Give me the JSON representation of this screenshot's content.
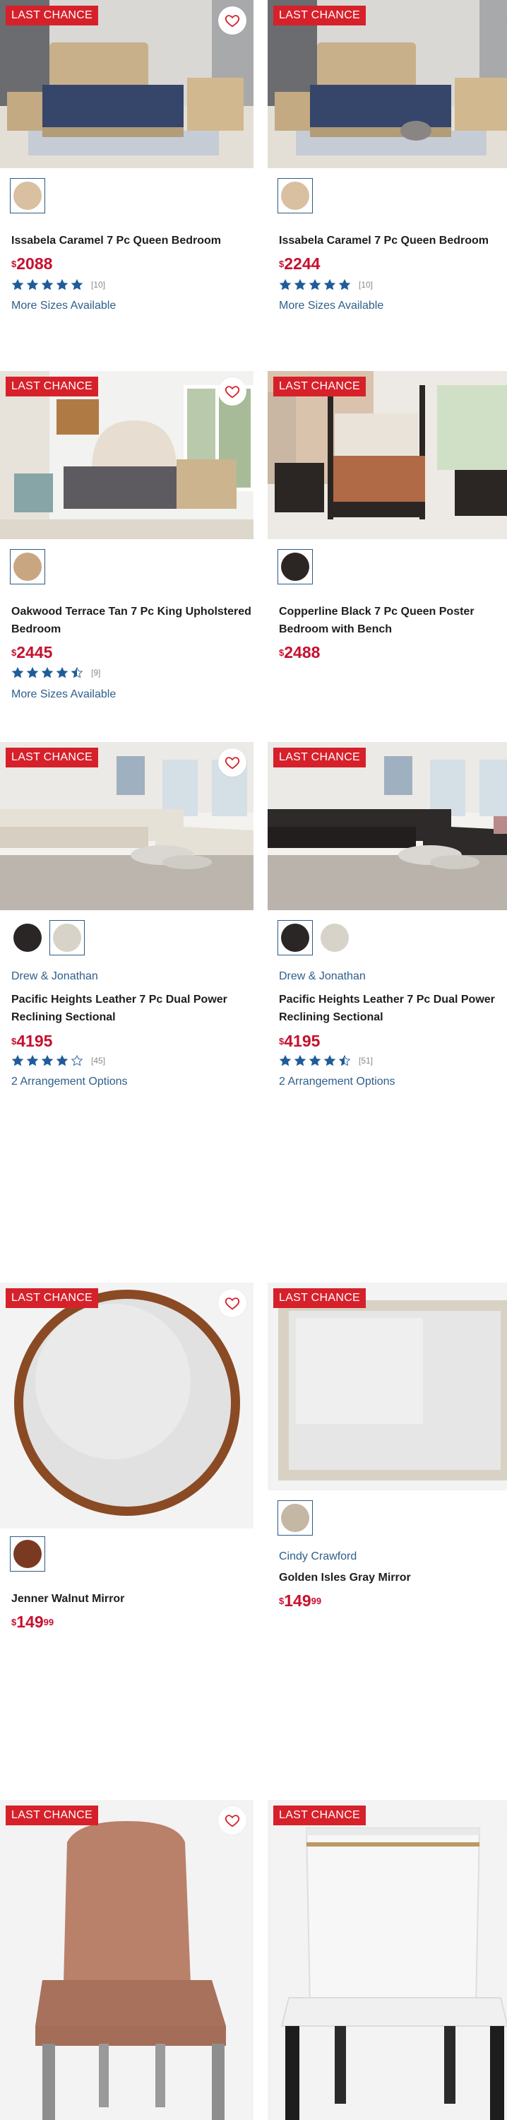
{
  "theme": {
    "badge_color": "#d6212b",
    "price_color": "#c8102e",
    "link_color": "#2d5f8a",
    "star_color": "#1f5c99"
  },
  "products": [
    {
      "badge": "LAST CHANCE",
      "title": "Issabela Caramel 7 Pc Queen Bedroom",
      "price": "2088",
      "rating": 5,
      "reviews": "[10]",
      "more": "More Sizes Available",
      "swatches": [
        "#d8c0a0"
      ]
    },
    {
      "badge": "LAST CHANCE",
      "title": "Issabela Caramel 7 Pc Queen Bedroom",
      "price": "2244",
      "rating": 5,
      "reviews": "[10]",
      "more": "More Sizes Available",
      "swatches": [
        "#d8c0a0"
      ]
    },
    {
      "badge": "LAST CHANCE",
      "title": "Oakwood Terrace Tan 7 Pc King Upholstered Bedroom",
      "price": "2445",
      "rating": 4.5,
      "reviews": "[9]",
      "more": "More Sizes Available",
      "swatches": [
        "#c9a682"
      ]
    },
    {
      "badge": "LAST CHANCE",
      "title": "Copperline Black 7 Pc Queen Poster Bedroom with Bench",
      "price": "2488",
      "swatches": [
        "#2b2624"
      ]
    },
    {
      "badge": "LAST CHANCE",
      "brand": "Drew & Jonathan",
      "title": "Pacific Heights Leather 7 Pc Dual Power Reclining Sectional",
      "price": "4195",
      "rating": 4,
      "reviews": "[45]",
      "more": "2 Arrangement Options",
      "swatches": [
        "#2a2625",
        "#d7d3c8"
      ]
    },
    {
      "badge": "LAST CHANCE",
      "brand": "Drew & Jonathan",
      "title": "Pacific Heights Leather 7 Pc Dual Power Reclining Sectional",
      "price": "4195",
      "rating": 4.5,
      "reviews": "[51]",
      "more": "2 Arrangement Options",
      "swatches": [
        "#2a2625",
        "#d7d3c8"
      ]
    },
    {
      "badge": "LAST CHANCE",
      "title": "Jenner Walnut Mirror",
      "price": "149",
      "cents": "99",
      "swatches": [
        "#7a3a22"
      ]
    },
    {
      "badge": "LAST CHANCE",
      "brand": "Cindy Crawford",
      "title": "Golden Isles Gray Mirror",
      "price": "149",
      "cents": "99",
      "swatches": [
        "#c4b7a4"
      ]
    },
    {
      "badge": "LAST CHANCE"
    },
    {
      "badge": "LAST CHANCE"
    }
  ]
}
